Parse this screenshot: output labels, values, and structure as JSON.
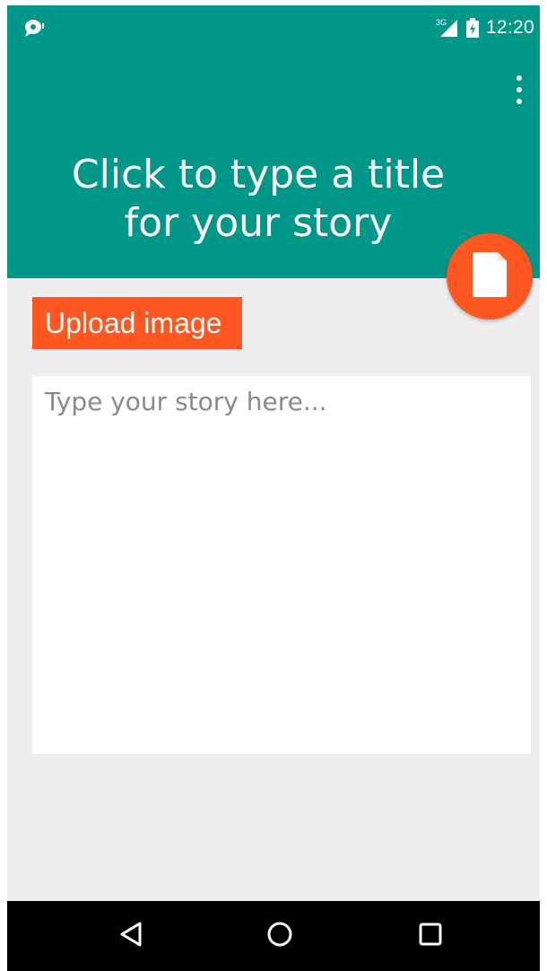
{
  "status_bar": {
    "time": "12:20",
    "network_label": "3G",
    "icons": [
      "notification-icon",
      "signal-3g-icon",
      "battery-charging-icon"
    ]
  },
  "app_bar": {
    "title_line1": "Click to type a title",
    "title_line2": "for your story",
    "overflow_icon": "more-vertical-icon"
  },
  "fab": {
    "icon": "document-icon"
  },
  "upload_button": {
    "label": "Upload image"
  },
  "story": {
    "placeholder": "Type your story here..."
  },
  "nav_bar": {
    "buttons": [
      "back-icon",
      "home-icon",
      "recents-icon"
    ]
  },
  "colors": {
    "primary": "#009688",
    "accent": "#ff5722",
    "background": "#eeeeee",
    "nav_bar": "#000000"
  }
}
